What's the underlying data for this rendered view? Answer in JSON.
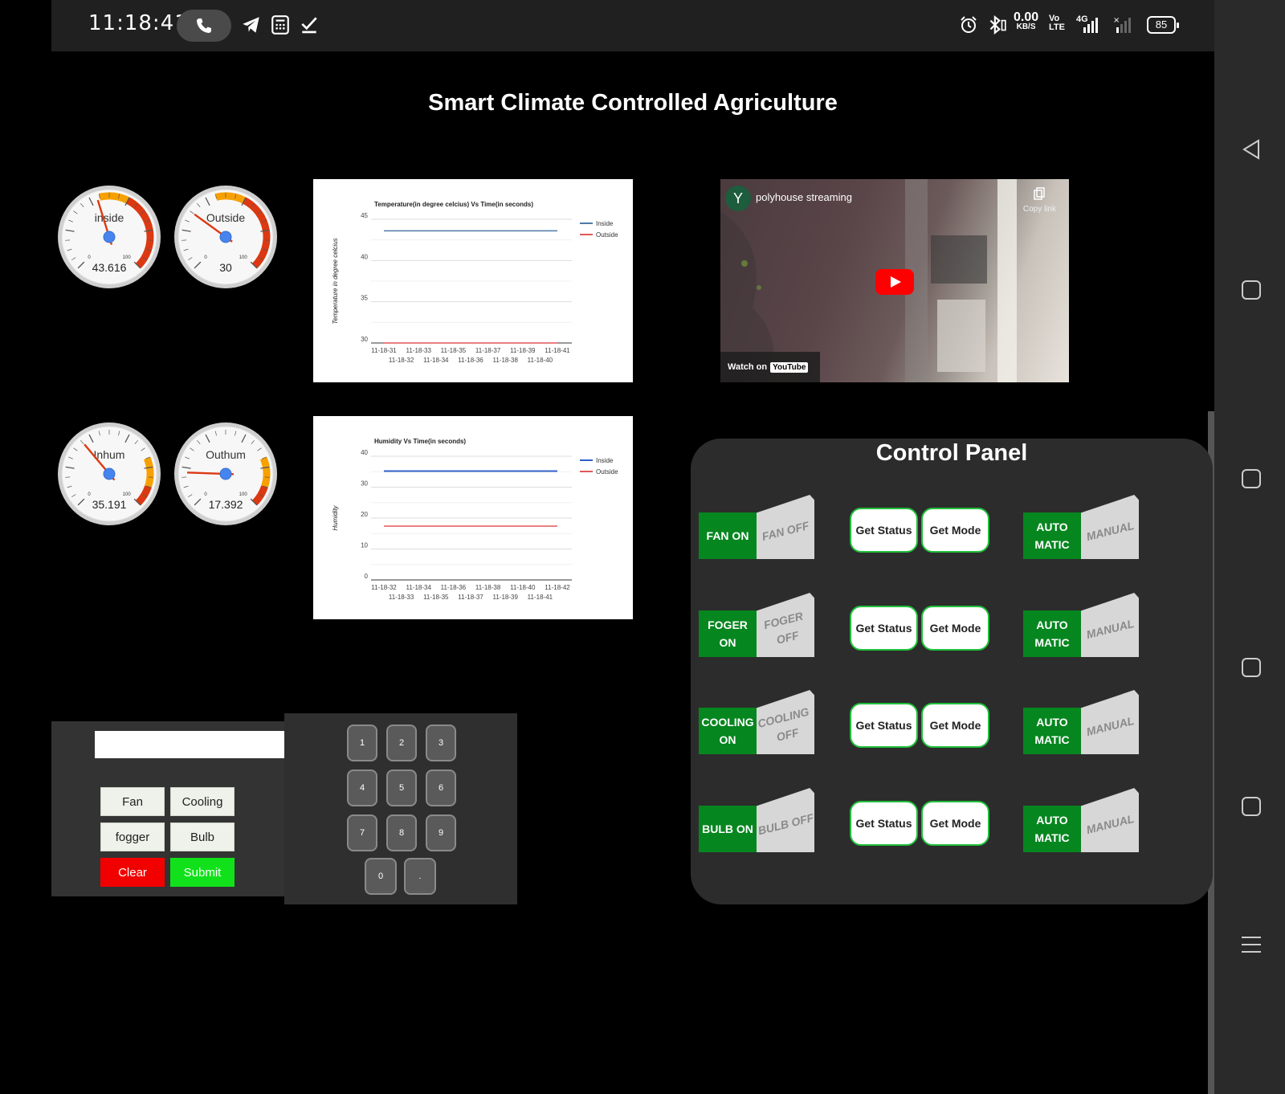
{
  "status_bar": {
    "time": "11:18:41",
    "net_speed": "0.00",
    "net_unit": "KB/S",
    "volte": "Vo",
    "lte": "LTE",
    "network": "4G",
    "battery": "85"
  },
  "page": {
    "title": "Smart Climate Controlled Agriculture"
  },
  "gauges": [
    {
      "label": "inside",
      "value": "43.616",
      "min": "0",
      "max": "100"
    },
    {
      "label": "Outside",
      "value": "30",
      "min": "0",
      "max": "100"
    },
    {
      "label": "Inhum",
      "value": "35.191",
      "min": "0",
      "max": "100"
    },
    {
      "label": "Outhum",
      "value": "17.392",
      "min": "0",
      "max": "100"
    }
  ],
  "temp_chart": {
    "title": "Temperature(in degree celcius) Vs Time(in seconds)",
    "ylabel": "Temperature in degree celcius",
    "legend": [
      "Inside",
      "Outside"
    ]
  },
  "hum_chart": {
    "title": "Humidity Vs Time(in seconds)",
    "ylabel": "Humidity",
    "legend": [
      "Inside",
      "Outside"
    ]
  },
  "chart_data": [
    {
      "type": "line",
      "title": "Temperature(in degree celcius) Vs Time(in seconds)",
      "xlabel": "",
      "ylabel": "Temperature in degree celcius",
      "ylim": [
        30,
        45
      ],
      "yticks": [
        "45",
        "40",
        "35",
        "30"
      ],
      "x": [
        "11-18-31",
        "11-18-32",
        "11-18-33",
        "11-18-34",
        "11-18-35",
        "11-18-36",
        "11-18-37",
        "11-18-38",
        "11-18-39",
        "11-18-40",
        "11-18-41"
      ],
      "series": [
        {
          "name": "Inside",
          "color": "#4e79a7",
          "values": [
            43.6,
            43.6,
            43.6,
            43.6,
            43.6,
            43.6,
            43.6,
            43.6,
            43.6,
            43.6,
            43.6
          ]
        },
        {
          "name": "Outside",
          "color": "#e15759",
          "values": [
            30,
            30,
            30,
            30,
            30,
            30,
            30,
            30,
            30,
            30,
            30
          ]
        }
      ],
      "legend_position": "top-right",
      "grid": true
    },
    {
      "type": "line",
      "title": "Humidity Vs Time(in seconds)",
      "xlabel": "",
      "ylabel": "Humidity",
      "ylim": [
        0,
        40
      ],
      "yticks": [
        "40",
        "30",
        "20",
        "10",
        "0"
      ],
      "x": [
        "11-18-32",
        "11-18-33",
        "11-18-34",
        "11-18-35",
        "11-18-36",
        "11-18-37",
        "11-18-38",
        "11-18-39",
        "11-18-40",
        "11-18-41",
        "11-18-42"
      ],
      "series": [
        {
          "name": "Inside",
          "color": "#3060c8",
          "values": [
            35.2,
            35.2,
            35.2,
            35.2,
            35.2,
            35.2,
            35.2,
            35.2,
            35.2,
            35.2,
            35.2
          ]
        },
        {
          "name": "Outside",
          "color": "#e15759",
          "values": [
            17.4,
            17.4,
            17.4,
            17.4,
            17.4,
            17.4,
            17.4,
            17.4,
            17.4,
            17.4,
            17.4
          ]
        }
      ],
      "legend_position": "top-right",
      "grid": true
    }
  ],
  "video": {
    "channel_initial": "Y",
    "title": "polyhouse streaming",
    "copy_link": "Copy link",
    "watch_on": "Watch on",
    "youtube": "YouTube"
  },
  "control_panel": {
    "title": "Control Panel",
    "rows": [
      {
        "on": "FAN ON",
        "off": "FAN OFF",
        "get_status": "Get Status",
        "get_mode": "Get Mode",
        "auto": "AUTO MATIC",
        "manual": "MANUAL"
      },
      {
        "on": "FOGER ON",
        "off": "FOGER OFF",
        "get_status": "Get Status",
        "get_mode": "Get Mode",
        "auto": "AUTO MATIC",
        "manual": "MANUAL"
      },
      {
        "on": "COOLING ON",
        "off": "COOLING OFF",
        "get_status": "Get Status",
        "get_mode": "Get Mode",
        "auto": "AUTO MATIC",
        "manual": "MANUAL"
      },
      {
        "on": "BULB ON",
        "off": "BULB OFF",
        "get_status": "Get Status",
        "get_mode": "Get Mode",
        "auto": "AUTO MATIC",
        "manual": "MANUAL"
      }
    ]
  },
  "form": {
    "input_value": "",
    "buttons": {
      "fan": "Fan",
      "cooling": "Cooling",
      "fogger": "fogger",
      "bulb": "Bulb",
      "clear": "Clear",
      "submit": "Submit"
    }
  },
  "keypad": {
    "keys": [
      "1",
      "2",
      "3",
      "4",
      "5",
      "6",
      "7",
      "8",
      "9",
      "0",
      "."
    ]
  }
}
